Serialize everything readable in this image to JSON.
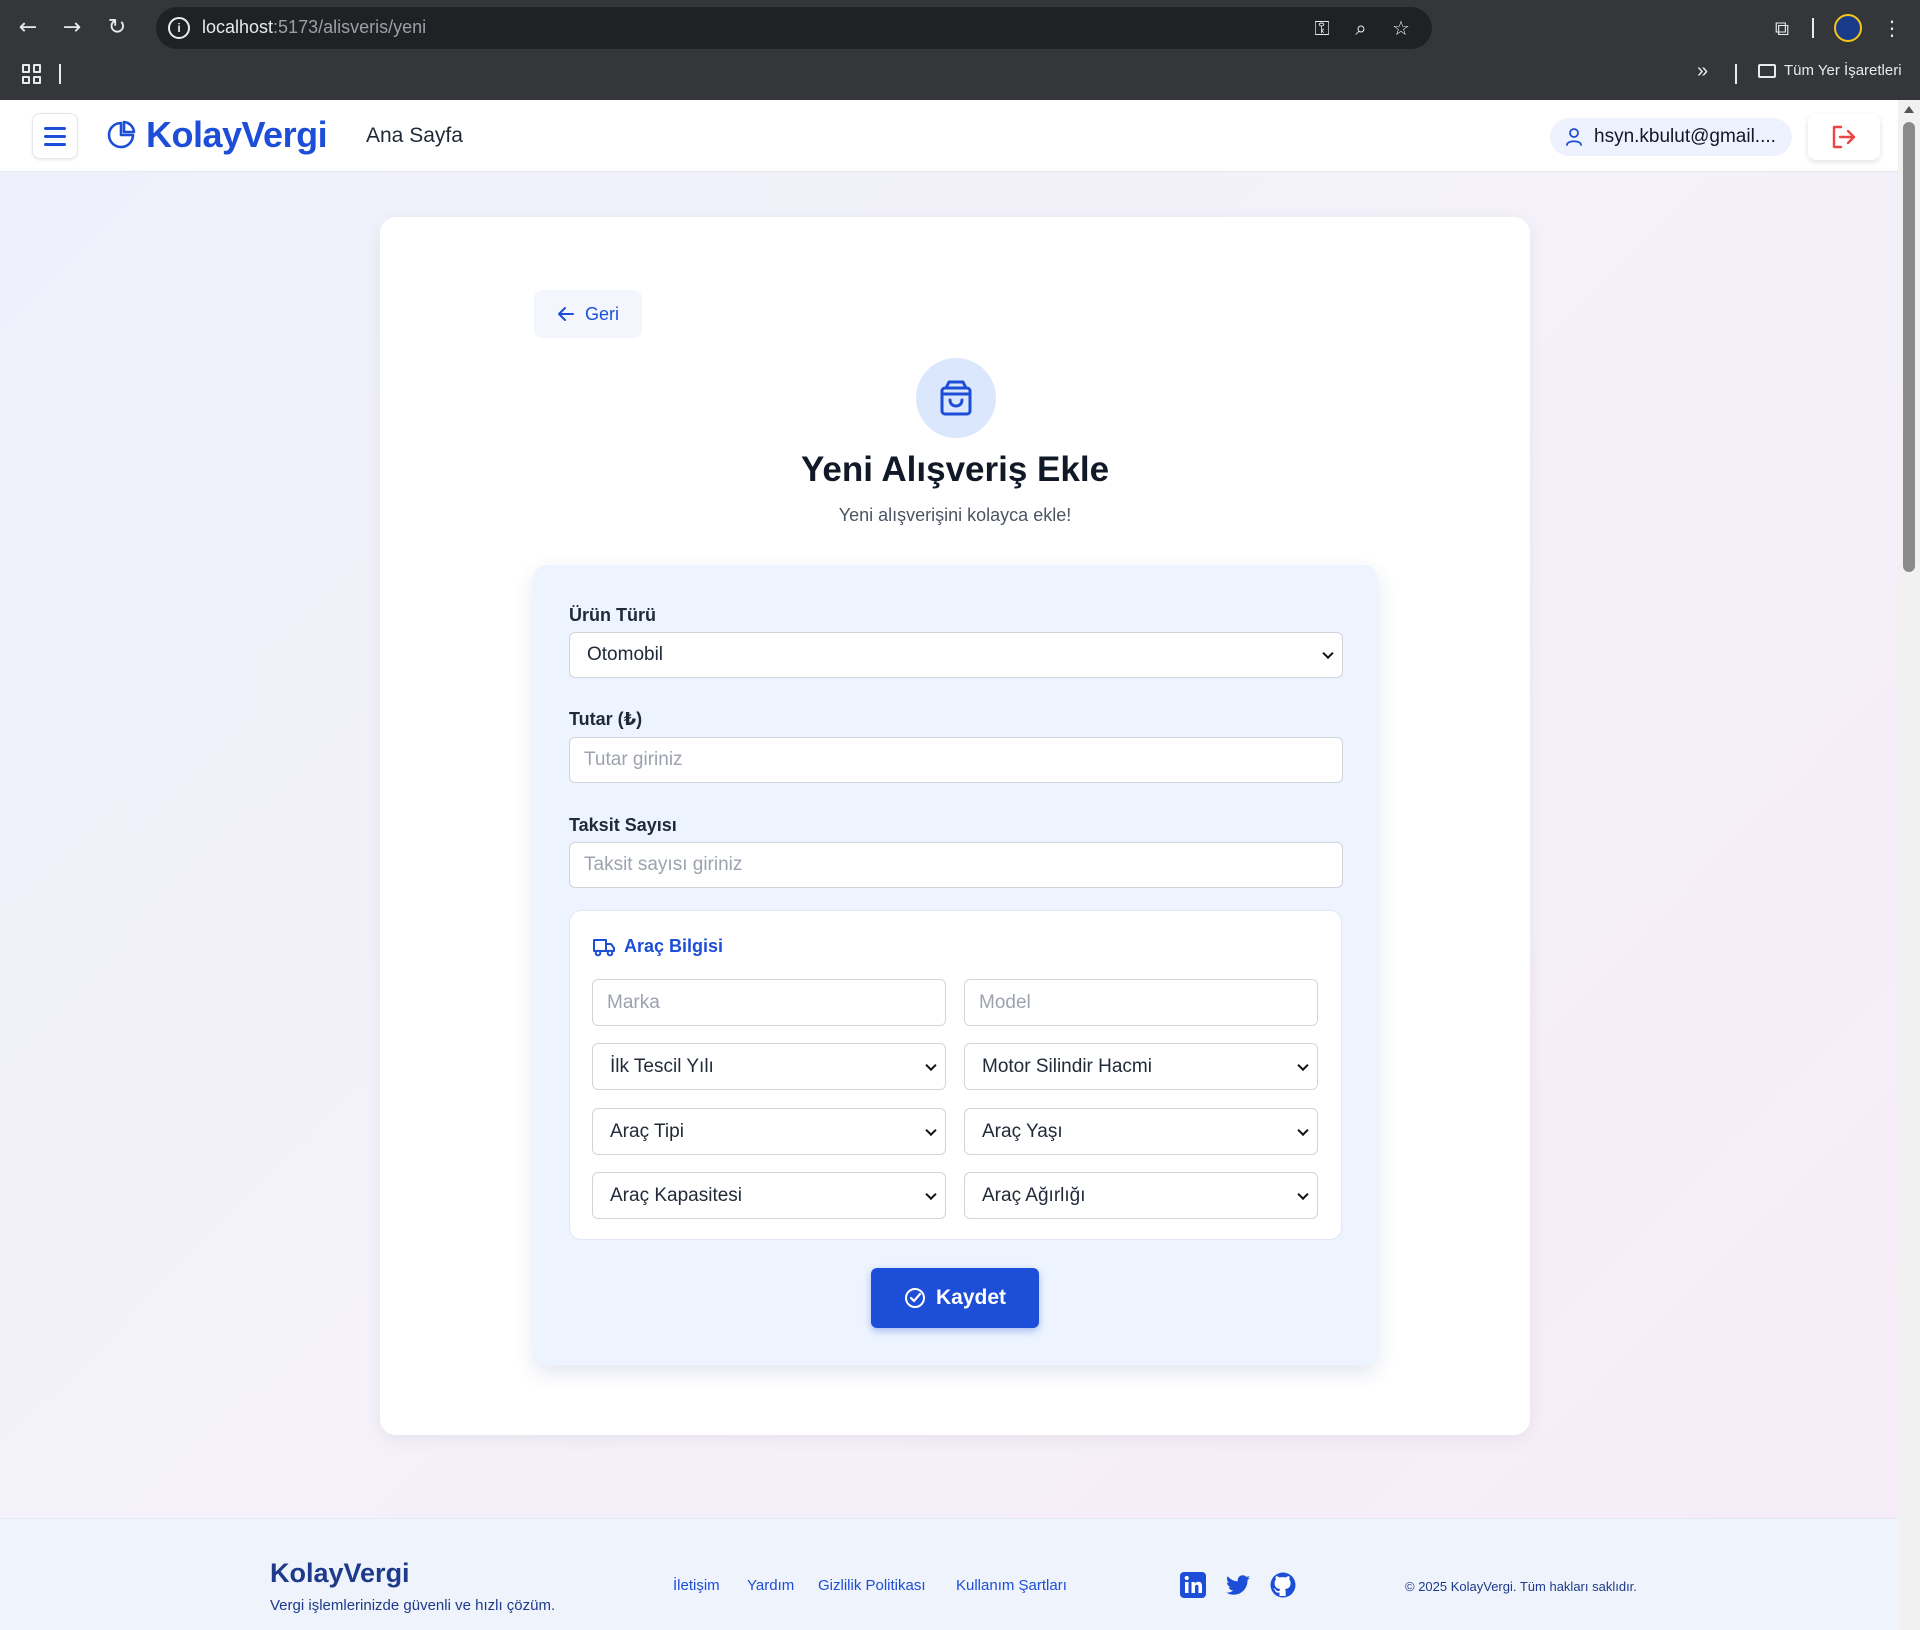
{
  "browser": {
    "url_host": "localhost",
    "url_path": ":5173/alisveris/yeni",
    "bookmarks_folder": "Tüm Yer İşaretleri",
    "overflow_glyph": "»"
  },
  "header": {
    "brand": "KolayVergi",
    "nav_home": "Ana Sayfa",
    "user_email": "hsyn.kbulut@gmail...."
  },
  "page": {
    "back_label": "Geri",
    "title": "Yeni Alışveriş Ekle",
    "subtitle": "Yeni alışverişini kolayca ekle!"
  },
  "form": {
    "product_type_label": "Ürün Türü",
    "product_type_value": "Otomobil",
    "amount_label": "Tutar (₺)",
    "amount_placeholder": "Tutar giriniz",
    "installments_label": "Taksit Sayısı",
    "installments_placeholder": "Taksit sayısı giriniz",
    "vehicle": {
      "title": "Araç Bilgisi",
      "brand_placeholder": "Marka",
      "model_placeholder": "Model",
      "registration_year": "İlk Tescil Yılı",
      "engine_volume": "Motor Silindir Hacmi",
      "vehicle_type": "Araç Tipi",
      "vehicle_age": "Araç Yaşı",
      "vehicle_capacity": "Araç Kapasitesi",
      "vehicle_weight": "Araç Ağırlığı"
    },
    "save_label": "Kaydet"
  },
  "footer": {
    "brand": "KolayVergi",
    "tagline": "Vergi işlemlerinizde güvenli ve hızlı çözüm.",
    "links": [
      "İletişim",
      "Yardım",
      "Gizlilik Politikası",
      "Kullanım Şartları"
    ],
    "copyright": "© 2025 KolayVergi. Tüm hakları saklıdır."
  },
  "colors": {
    "primary": "#1d4ed8",
    "danger": "#ef4444",
    "panel": "#eef4ff"
  }
}
